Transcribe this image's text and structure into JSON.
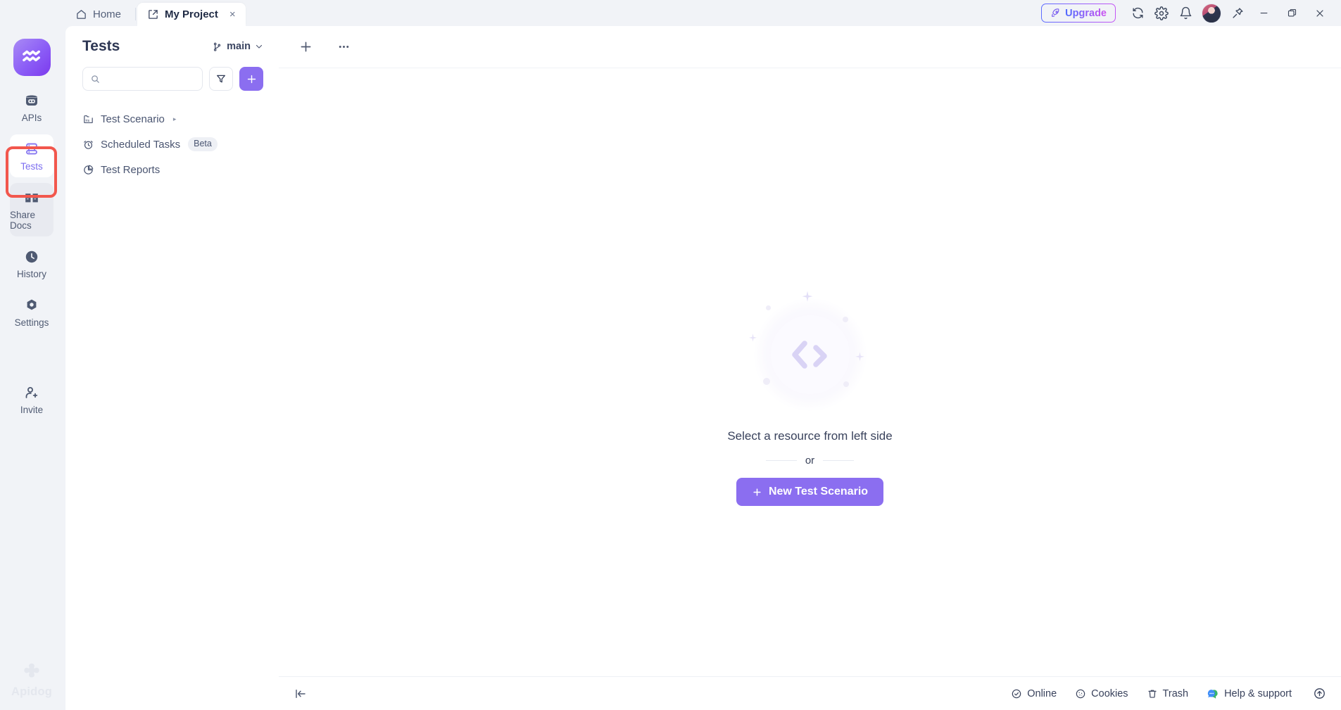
{
  "window": {
    "tabs": [
      {
        "label": "Home",
        "icon": "home-icon",
        "active": false
      },
      {
        "label": "My Project",
        "icon": "external-link-icon",
        "active": true,
        "close": "×"
      }
    ],
    "upgrade_label": "Upgrade",
    "upgrade_icon": "rocket-icon",
    "controls": [
      {
        "name": "sync-icon"
      },
      {
        "name": "gear-icon"
      },
      {
        "name": "bell-icon"
      },
      {
        "name": "avatar"
      },
      {
        "name": "pin-icon"
      },
      {
        "name": "minimize-icon"
      },
      {
        "name": "maximize-icon"
      },
      {
        "name": "close-icon"
      }
    ],
    "accent_purple": "#8b6ef0",
    "annotation_color": "#f2574d"
  },
  "rail": {
    "logo": "apidog-logo",
    "items": [
      {
        "label": "APIs",
        "icon": "apis-icon",
        "state": "default"
      },
      {
        "label": "Tests",
        "icon": "tests-icon",
        "state": "active"
      },
      {
        "label": "Share Docs",
        "icon": "share-docs-icon",
        "state": "hover"
      },
      {
        "label": "History",
        "icon": "history-clock-icon",
        "state": "default"
      },
      {
        "label": "Settings",
        "icon": "settings-gear-icon",
        "state": "default"
      },
      {
        "label": "Invite",
        "icon": "invite-user-icon",
        "state": "default"
      }
    ],
    "brand": "Apidog"
  },
  "panel": {
    "title": "Tests",
    "branch": {
      "label": "main",
      "icon": "branch-icon",
      "chevron": "chevron-down-icon"
    },
    "search": {
      "value": "",
      "placeholder": ""
    },
    "filter_icon": "filter-icon",
    "add_label": "+",
    "tree": [
      {
        "label": "Test Scenario",
        "icon": "test-scenario-folder-icon",
        "caret": "▸",
        "badge": null
      },
      {
        "label": "Scheduled Tasks",
        "icon": "alarm-clock-icon",
        "caret": null,
        "badge": "Beta"
      },
      {
        "label": "Test Reports",
        "icon": "pie-chart-icon",
        "caret": null,
        "badge": null
      }
    ]
  },
  "main": {
    "toolbar": [
      {
        "name": "add-button",
        "icon": "plus-icon"
      },
      {
        "name": "more-button",
        "icon": "ellipsis-icon"
      }
    ],
    "empty": {
      "illustration": "code-brackets-icon",
      "title": "Select a resource from left side",
      "or_label": "or",
      "cta_label": "New Test Scenario",
      "cta_icon": "plus-icon"
    }
  },
  "statusbar": {
    "collapse_icon": "collapse-panel-icon",
    "items": [
      {
        "label": "Online",
        "icon": "check-circle-icon"
      },
      {
        "label": "Cookies",
        "icon": "cookie-icon"
      },
      {
        "label": "Trash",
        "icon": "trash-icon"
      },
      {
        "label": "Help & support",
        "icon": "chat-support-icon"
      }
    ],
    "scroll_top_icon": "arrow-up-circle-icon"
  }
}
